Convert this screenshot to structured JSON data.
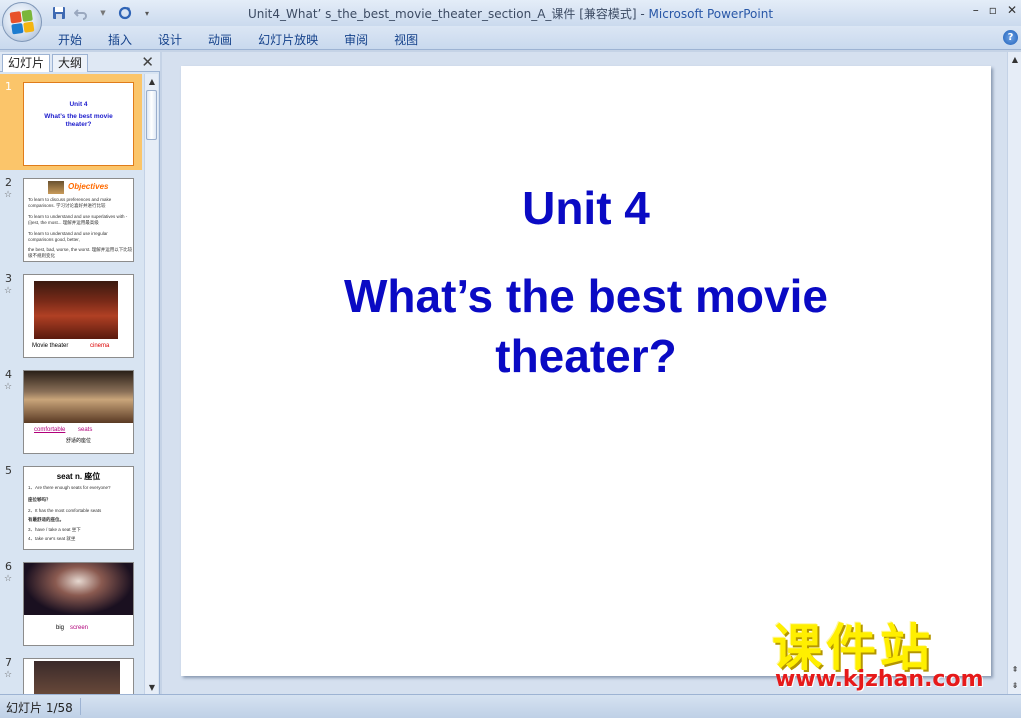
{
  "window": {
    "title_doc": "Unit4_What’  s_the_best_movie_theater_section_A_课件 [兼容模式] - ",
    "title_app": "Microsoft PowerPoint"
  },
  "ribbon": {
    "tabs": [
      "开始",
      "插入",
      "设计",
      "动画",
      "幻灯片放映",
      "审阅",
      "视图"
    ]
  },
  "left_pane": {
    "tab_slides": "幻灯片",
    "tab_outline": "大纲",
    "slides": [
      {
        "num": "1",
        "title": "Unit 4",
        "subtitle": "What’s the best movie theater?"
      },
      {
        "num": "2",
        "heading": "Objectives",
        "lines": [
          "To learn to discuss preferences and make comparisons. 学习讨论喜好并进行比较",
          "To learn to understand and use superlatives with -(i)est, the most... 理解并运用最高级",
          "To learn to understand and use irregular comparisons good, better,",
          "the best, bad, worse, the worst. 理解并运用以下比较级不规则变化"
        ]
      },
      {
        "num": "3",
        "caption_a": "Movie theater",
        "caption_b": "cinema"
      },
      {
        "num": "4",
        "caption_a": "comfortable",
        "caption_b": "seats",
        "caption_c": "舒适的座位"
      },
      {
        "num": "5",
        "heading": "seat n. 座位",
        "lines": [
          "1、Are there enough seats for everyone?",
          "座位够吗？",
          "2、It has the most comfortable seats",
          "有最舒适的座位。",
          "3、have / take a seat 坐下",
          "4、take one's seat 就坐"
        ]
      },
      {
        "num": "6",
        "caption_a": "big",
        "caption_b": "screen"
      },
      {
        "num": "7"
      }
    ]
  },
  "slide": {
    "title": "Unit 4",
    "subtitle_line1": "What’s the best movie",
    "subtitle_line2": "theater?"
  },
  "watermark": {
    "big": "课件站",
    "small": "www.kjzhan.com"
  },
  "status": {
    "slide_counter": "幻灯片 1/58"
  }
}
